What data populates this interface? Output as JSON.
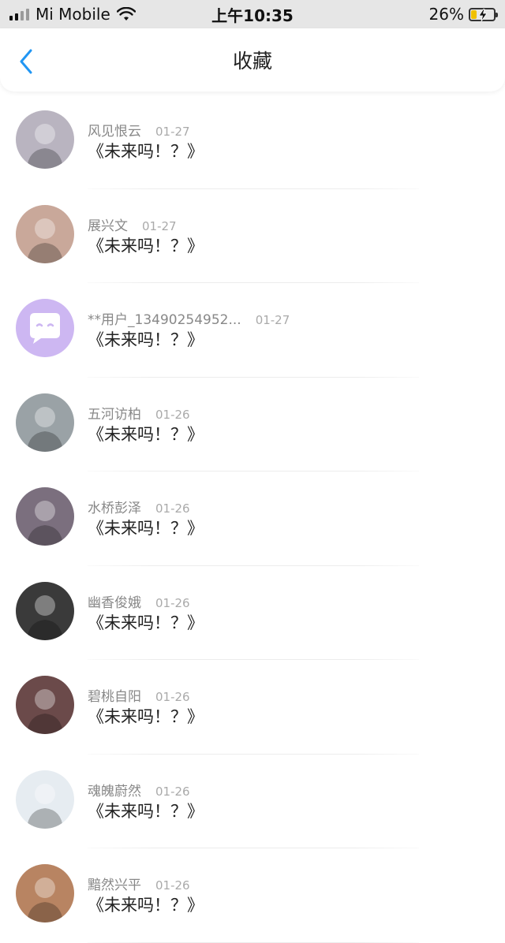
{
  "status_bar": {
    "carrier": "Mi Mobile",
    "time": "上午10:35",
    "battery": "26%",
    "battery_level": 0.26
  },
  "header": {
    "title": "收藏",
    "back_icon": "chevron-left-icon",
    "accent": "#2196f3"
  },
  "items": [
    {
      "username": "风见恨云",
      "date": "01-27",
      "content": "《未来吗！？》",
      "avatar_color": "#b9b4c0"
    },
    {
      "username": "展兴文",
      "date": "01-27",
      "content": "《未来吗！？》",
      "avatar_color": "#c9a89a"
    },
    {
      "username": "**用户_13490254952...",
      "date": "01-27",
      "content": "《未来吗！？》",
      "avatar_color": "#cdb7f2"
    },
    {
      "username": "五河访柏",
      "date": "01-26",
      "content": "《未来吗！？》",
      "avatar_color": "#9aa2a6"
    },
    {
      "username": "水桥彭泽",
      "date": "01-26",
      "content": "《未来吗！？》",
      "avatar_color": "#7b6f7e"
    },
    {
      "username": "幽香俊娥",
      "date": "01-26",
      "content": "《未来吗！？》",
      "avatar_color": "#3a3a3a"
    },
    {
      "username": "碧桃自阳",
      "date": "01-26",
      "content": "《未来吗！？》",
      "avatar_color": "#6b4a4a"
    },
    {
      "username": "魂魄蔚然",
      "date": "01-26",
      "content": "《未来吗！？》",
      "avatar_color": "#e6ecf1"
    },
    {
      "username": "黯然兴平",
      "date": "01-26",
      "content": "《未来吗！？》",
      "avatar_color": "#b88462"
    }
  ]
}
